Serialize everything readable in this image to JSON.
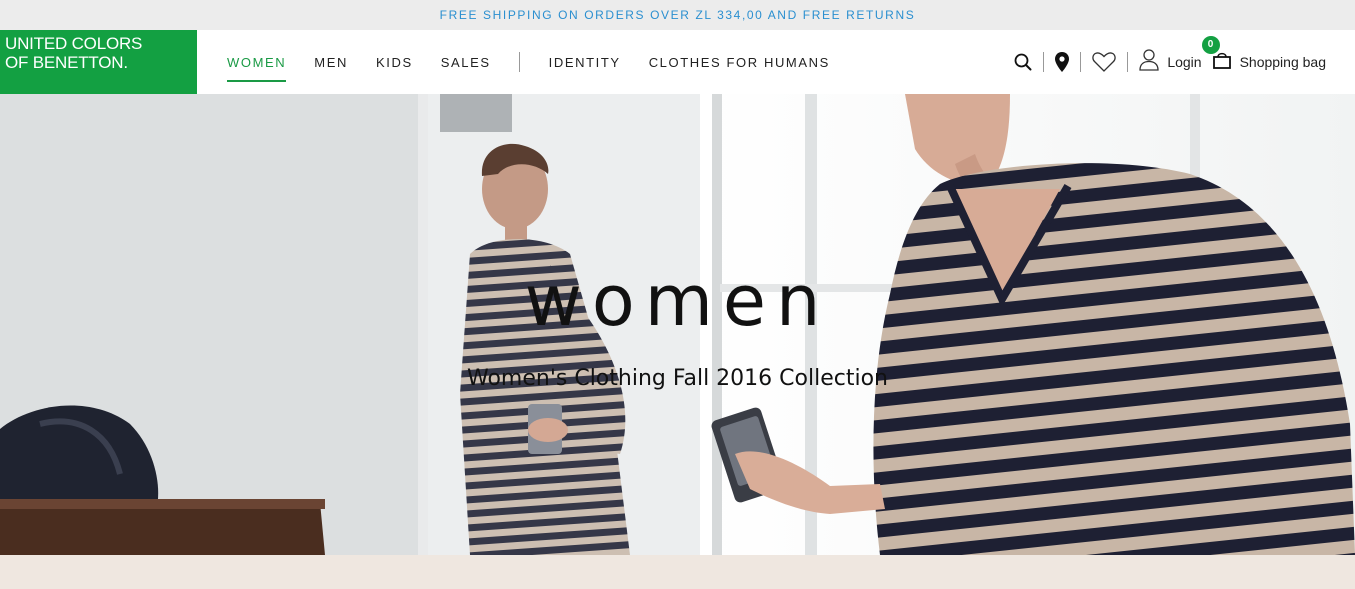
{
  "promo": {
    "text": "FREE SHIPPING ON ORDERS OVER ZL 334,00 AND FREE RETURNS"
  },
  "logo": {
    "line1": "UNITED COLORS",
    "line2": "OF BENETTON."
  },
  "nav": {
    "women": "WOMEN",
    "men": "MEN",
    "kids": "KIDS",
    "sales": "SALES",
    "identity": "IDENTITY",
    "clothes_for_humans": "CLOTHES FOR HUMANS"
  },
  "tools": {
    "icons": [
      "search-icon",
      "location-pin-icon",
      "heart-icon",
      "user-icon",
      "shopping-bag-icon"
    ],
    "login_label": "Login",
    "bag_label": "Shopping bag",
    "bag_count": "0"
  },
  "hero": {
    "title": "women",
    "subtitle": "Women's Clothing Fall 2016 Collection"
  },
  "colors": {
    "brand_green": "#13a042",
    "promo_text": "#2a8fd0",
    "stripe_navy": "#1e2033",
    "stripe_beige": "#c8b6a6"
  }
}
